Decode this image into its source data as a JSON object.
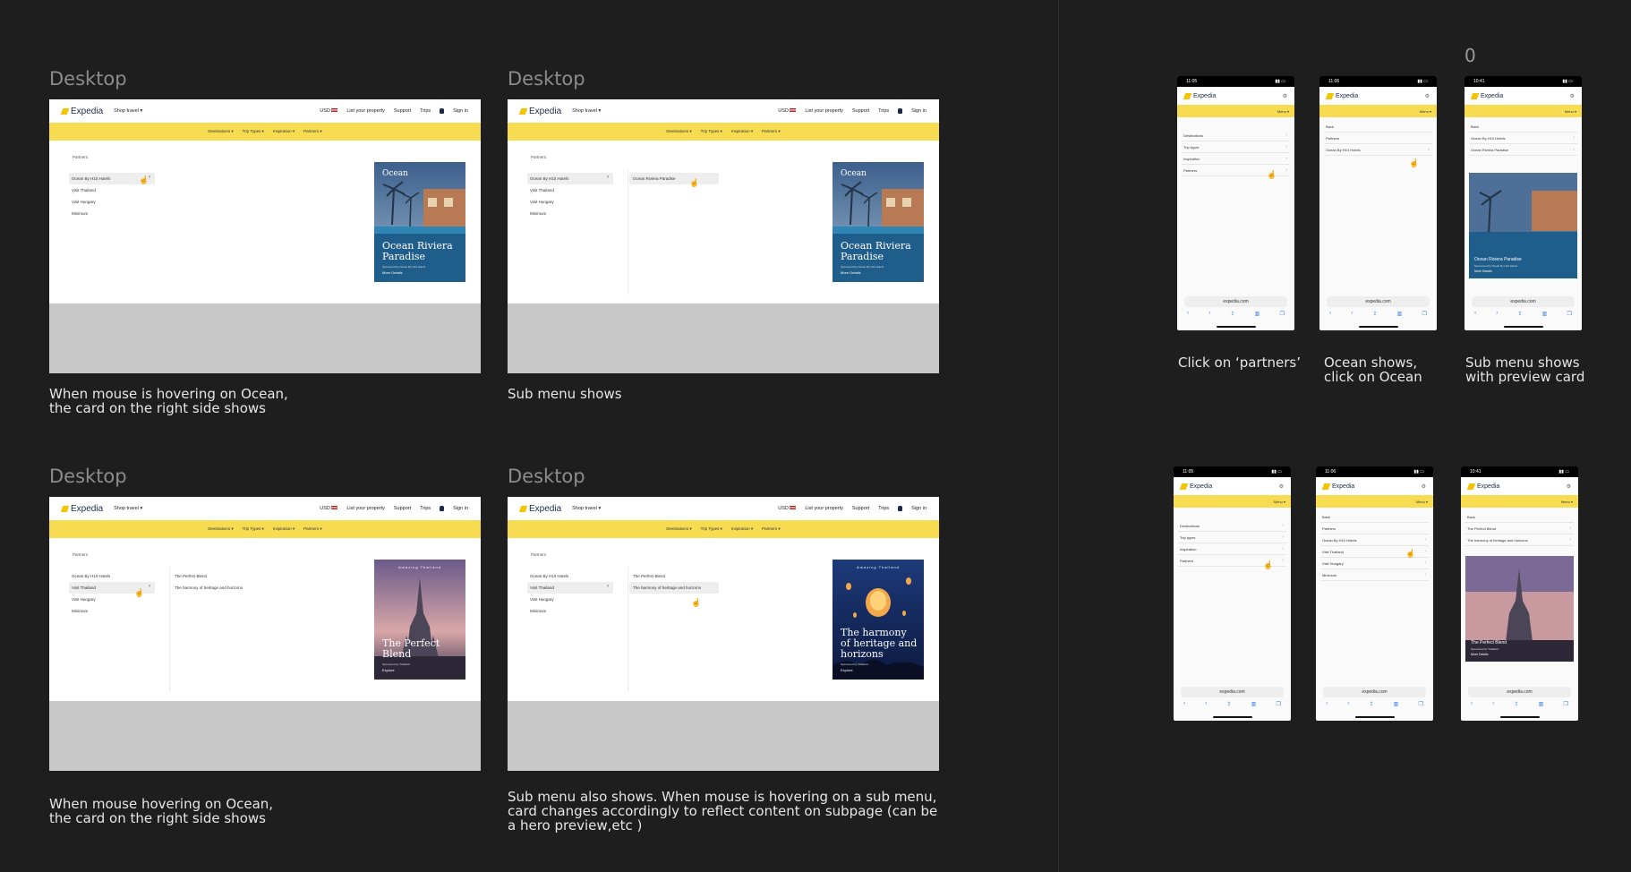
{
  "nav": {
    "logo": "Expedia",
    "shop_travel": "Shop travel",
    "currency": "USD",
    "list_property": "List your property",
    "support": "Support",
    "trips": "Trips",
    "sign_in": "Sign in"
  },
  "subnav": {
    "destinations": "Destinations",
    "trip_types": "Trip Types",
    "inspiration": "Inspiration",
    "partners": "Partners"
  },
  "breadcrumb": "Partners",
  "partners": [
    "Ocean By H10 Hotels",
    "Visit Thailand",
    "Visit Hungary",
    "Minimum"
  ],
  "frames": [
    {
      "label": "Desktop",
      "caption": "When mouse is hovering on Ocean,\nthe card on the right side shows",
      "submenu": [],
      "card": {
        "brand": "Ocean",
        "title": "Ocean Riviera Paradise",
        "sub": "Sponsored by Ocean By H10 Hotels",
        "link": "More Details"
      }
    },
    {
      "label": "Desktop",
      "caption": "Sub menu shows",
      "submenu": [
        "Ocean Riviera Paradise"
      ],
      "card": {
        "brand": "Ocean",
        "title": "Ocean Riviera Paradise",
        "sub": "Sponsored by Ocean By H10 Hotels",
        "link": "More Details"
      }
    },
    {
      "label": "Desktop",
      "caption": "When mouse hovering on Ocean,\nthe card on the right side shows",
      "submenu": [
        "The Perfect Blend",
        "The harmony of heritage and horizons"
      ],
      "card": {
        "brand": "Amazing Thailand",
        "title": "The Perfect Blend",
        "sub": "Sponsored by Thailand",
        "link": "Explore"
      }
    },
    {
      "label": "Desktop",
      "caption": "Sub menu also shows. When mouse is hovering on a sub menu,\ncard changes accordingly to reflect content on subpage (can be\na hero preview,etc )",
      "submenu": [
        "The Perfect Blend",
        "The harmony of heritage and horizons"
      ],
      "card": {
        "brand": "Amazing Thailand",
        "title": "The harmony of heritage and horizons",
        "sub": "Sponsored by Thailand",
        "link": "Explore"
      }
    }
  ],
  "mobile": {
    "top_number": "0",
    "menu": "Menu",
    "back": "Back",
    "url": "expedia.com",
    "menu_items": [
      "Destinations",
      "Trip types",
      "Inspiration",
      "Partners"
    ],
    "captions": [
      "Click on ‘partners’",
      "Ocean shows,\nclick on Ocean",
      "Sub menu shows\nwith preview card"
    ],
    "row1": {
      "times": [
        "11:05",
        "11:06",
        "10:41"
      ],
      "phone2_items": [
        "Ocean By H10 Hotels"
      ],
      "phone3_items": [
        "Ocean By H10 Hotels",
        "Ocean Riviera Paradise"
      ],
      "phone3_card": {
        "title": "Ocean Riviera Paradise",
        "sub": "Sponsored by Ocean By H10 Hotels",
        "link": "More Details"
      }
    },
    "row2": {
      "times": [
        "11:05",
        "11:06",
        "10:41"
      ],
      "phone2_items": [
        "Ocean By H10 Hotels",
        "Visit Thailand",
        "Visit Hungary",
        "Minimum"
      ],
      "phone3_items": [
        "The Perfect Blend",
        "The harmony of heritage and horizons"
      ],
      "phone3_card": {
        "title": "The Perfect Blend",
        "sub": "Sponsored by Thailand",
        "link": "More Details"
      }
    }
  }
}
